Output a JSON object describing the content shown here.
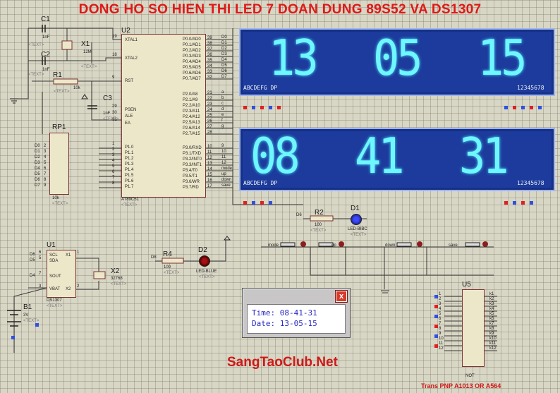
{
  "title": "DONG HO SO HIEN THI LED 7 DOAN DUNG 89S52 VA DS1307",
  "footer": "SangTaoClub.Net",
  "transistor_note": "Trans PNP A1013 OR A564",
  "components": {
    "c1": {
      "ref": "C1",
      "value": "1nF"
    },
    "c2": {
      "ref": "C2",
      "value": "1nF"
    },
    "c3": {
      "ref": "C3",
      "value": "1nF"
    },
    "x1": {
      "ref": "X1",
      "value": "12M"
    },
    "x2": {
      "ref": "X2",
      "value": "32768"
    },
    "r1": {
      "ref": "R1",
      "value": "10k"
    },
    "r2": {
      "ref": "R2",
      "value": "100"
    },
    "r4": {
      "ref": "R4",
      "value": "100"
    },
    "rp1": {
      "ref": "RP1",
      "value": "10k"
    },
    "u1": {
      "ref": "U1",
      "part": "DS1307"
    },
    "u2": {
      "ref": "U2",
      "part": "AT89C51"
    },
    "u5": {
      "ref": "U5",
      "part": "NOT"
    },
    "b1": {
      "ref": "B1",
      "value": "3V"
    },
    "d1": {
      "ref": "D1",
      "part": "LED-BIBC"
    },
    "d2": {
      "ref": "D2",
      "part": "LED-BLUE"
    },
    "text_tag": "<TEXT>"
  },
  "mcu_pins_left": [
    {
      "num": "19",
      "name": "XTAL1"
    },
    {
      "num": "18",
      "name": "XTAL2"
    },
    {
      "num": "9",
      "name": "RST"
    },
    {
      "num": "29",
      "name": "PSEN"
    },
    {
      "num": "30",
      "name": "ALE"
    },
    {
      "num": "31",
      "name": "EA"
    },
    {
      "num": "1",
      "name": "P1.0"
    },
    {
      "num": "2",
      "name": "P1.1"
    },
    {
      "num": "3",
      "name": "P1.2"
    },
    {
      "num": "4",
      "name": "P1.3"
    },
    {
      "num": "5",
      "name": "P1.4"
    },
    {
      "num": "6",
      "name": "P1.5"
    },
    {
      "num": "7",
      "name": "P1.6"
    },
    {
      "num": "8",
      "name": "P1.7"
    }
  ],
  "mcu_pins_right": [
    {
      "num": "39",
      "name": "P0.0/AD0",
      "net": "D0"
    },
    {
      "num": "38",
      "name": "P0.1/AD1",
      "net": "D1"
    },
    {
      "num": "37",
      "name": "P0.2/AD2",
      "net": "D2"
    },
    {
      "num": "36",
      "name": "P0.3/AD3",
      "net": "D3"
    },
    {
      "num": "35",
      "name": "P0.4/AD4",
      "net": "D4"
    },
    {
      "num": "34",
      "name": "P0.5/AD5",
      "net": "D5"
    },
    {
      "num": "33",
      "name": "P0.6/AD6",
      "net": "D6"
    },
    {
      "num": "32",
      "name": "P0.7/AD7",
      "net": "D7"
    },
    {
      "num": "21",
      "name": "P2.0/A8",
      "net": "a"
    },
    {
      "num": "22",
      "name": "P2.1/A9",
      "net": "b"
    },
    {
      "num": "23",
      "name": "P2.2/A10",
      "net": "c"
    },
    {
      "num": "24",
      "name": "P2.3/A11",
      "net": "d"
    },
    {
      "num": "25",
      "name": "P2.4/A12",
      "net": "e"
    },
    {
      "num": "26",
      "name": "P2.5/A13",
      "net": "f"
    },
    {
      "num": "27",
      "name": "P2.6/A14",
      "net": "g"
    },
    {
      "num": "28",
      "name": "P2.7/A15",
      "net": ""
    },
    {
      "num": "10",
      "name": "P3.0/RXD",
      "net": "9"
    },
    {
      "num": "11",
      "name": "P3.1/TXD",
      "net": "10"
    },
    {
      "num": "12",
      "name": "P3.2/INT0",
      "net": "11"
    },
    {
      "num": "13",
      "name": "P3.3/INT1",
      "net": "12"
    },
    {
      "num": "14",
      "name": "P3.4/T0",
      "net": "mode"
    },
    {
      "num": "15",
      "name": "P3.5/T1",
      "net": "up"
    },
    {
      "num": "16",
      "name": "P3.6/WR",
      "net": "down"
    },
    {
      "num": "17",
      "name": "P3.7/RD",
      "net": "save"
    }
  ],
  "rp1_nets": [
    "D0",
    "D1",
    "D2",
    "D3",
    "D4",
    "D5",
    "D6",
    "D7"
  ],
  "display_top": {
    "digits": "13 05 15",
    "seg_labels": "ABCDEFG DP",
    "pos_labels": "12345678"
  },
  "display_bottom": {
    "digits": "08 41 31",
    "seg_labels": "ABCDEFG DP",
    "pos_labels": "12345678"
  },
  "ds1307_pins": [
    {
      "num": "6",
      "name": "SCL",
      "net": "D6"
    },
    {
      "num": "5",
      "name": "SDA",
      "net": "D5"
    },
    {
      "num": "7",
      "name": "SOUT",
      "net": "D4"
    },
    {
      "num": "3",
      "name": "VBAT",
      "net": ""
    },
    {
      "num": "1",
      "name": "X1",
      "net": ""
    },
    {
      "num": "2",
      "name": "X2",
      "net": ""
    }
  ],
  "buttons": [
    "mode",
    "up",
    "down",
    "save"
  ],
  "d6_net": "D6",
  "d8_net": "D8",
  "dialog": {
    "close_label": "x",
    "time_label": "Time:",
    "time_value": "08-41-31",
    "date_label": "Date:",
    "date_value": "13-05-15"
  },
  "u5_inputs": [
    "1",
    "2",
    "3",
    "4",
    "5",
    "6",
    "7",
    "8",
    "9",
    "10",
    "11",
    "12"
  ],
  "u5_outputs": [
    "k1",
    "k2",
    "k3",
    "k4",
    "k5",
    "k6",
    "k7",
    "k8",
    "k9",
    "k10",
    "k11",
    "k12"
  ]
}
